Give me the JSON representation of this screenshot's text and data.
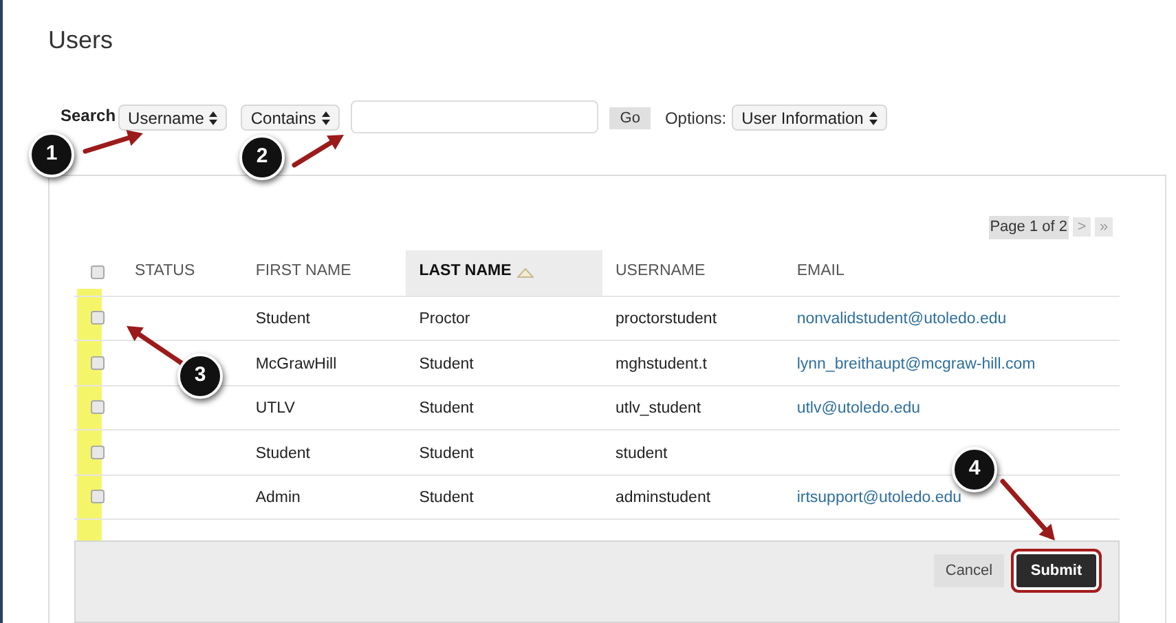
{
  "page_title": "Users",
  "search": {
    "label": "Search",
    "field_select": "Username",
    "operator_select": "Contains",
    "button": "Go",
    "options_label": "Options:",
    "options_select": "User Information"
  },
  "pagination": {
    "text": "Page 1 of 2",
    "next": ">",
    "last": "»"
  },
  "table": {
    "select_all_checked": false,
    "columns": [
      {
        "label": "STATUS",
        "sorted": false
      },
      {
        "label": "FIRST NAME",
        "sorted": false
      },
      {
        "label": "LAST NAME",
        "sorted": true
      },
      {
        "label": "USERNAME",
        "sorted": false
      },
      {
        "label": "EMAIL",
        "sorted": false
      }
    ],
    "rows": [
      {
        "checked": false,
        "first_name": "Student",
        "last_name": "Proctor",
        "username": "proctorstudent",
        "email": "nonvalidstudent@utoledo.edu"
      },
      {
        "checked": false,
        "first_name": "McGrawHill",
        "last_name": "Student",
        "username": "mghstudent.t",
        "email": "lynn_breithaupt@mcgraw-hill.com"
      },
      {
        "checked": false,
        "first_name": "UTLV",
        "last_name": "Student",
        "username": "utlv_student",
        "email": "utlv@utoledo.edu"
      },
      {
        "checked": false,
        "first_name": "Student",
        "last_name": "Student",
        "username": "student"
      },
      {
        "checked": false,
        "first_name": "Admin",
        "last_name": "Student",
        "username": "adminstudent",
        "email": "irtsupport@utoledo.edu"
      }
    ]
  },
  "footer": {
    "cancel": "Cancel",
    "submit": "Submit"
  },
  "callouts": [
    "1",
    "2",
    "3",
    "4"
  ]
}
